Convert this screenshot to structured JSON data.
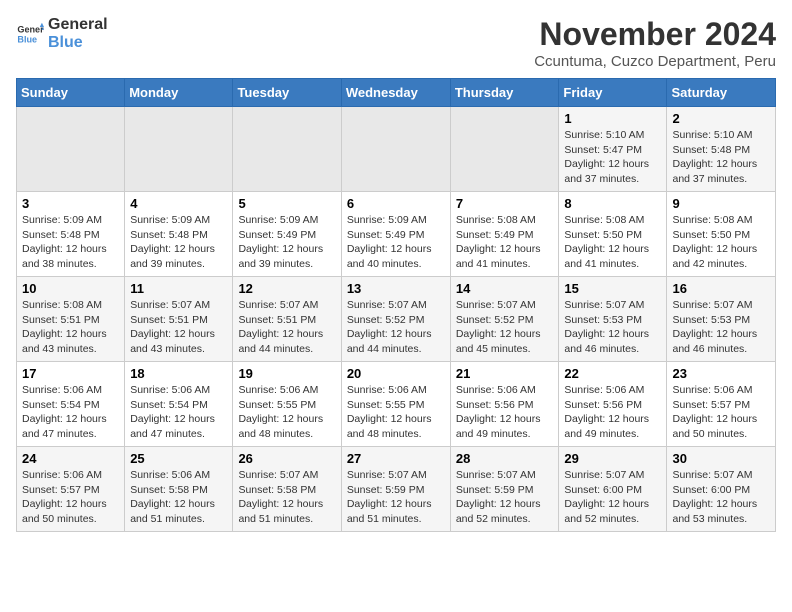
{
  "logo": {
    "line1": "General",
    "line2": "Blue"
  },
  "title": "November 2024",
  "subtitle": "Ccuntuma, Cuzco Department, Peru",
  "weekdays": [
    "Sunday",
    "Monday",
    "Tuesday",
    "Wednesday",
    "Thursday",
    "Friday",
    "Saturday"
  ],
  "weeks": [
    [
      {
        "day": "",
        "info": ""
      },
      {
        "day": "",
        "info": ""
      },
      {
        "day": "",
        "info": ""
      },
      {
        "day": "",
        "info": ""
      },
      {
        "day": "",
        "info": ""
      },
      {
        "day": "1",
        "info": "Sunrise: 5:10 AM\nSunset: 5:47 PM\nDaylight: 12 hours\nand 37 minutes."
      },
      {
        "day": "2",
        "info": "Sunrise: 5:10 AM\nSunset: 5:48 PM\nDaylight: 12 hours\nand 37 minutes."
      }
    ],
    [
      {
        "day": "3",
        "info": "Sunrise: 5:09 AM\nSunset: 5:48 PM\nDaylight: 12 hours\nand 38 minutes."
      },
      {
        "day": "4",
        "info": "Sunrise: 5:09 AM\nSunset: 5:48 PM\nDaylight: 12 hours\nand 39 minutes."
      },
      {
        "day": "5",
        "info": "Sunrise: 5:09 AM\nSunset: 5:49 PM\nDaylight: 12 hours\nand 39 minutes."
      },
      {
        "day": "6",
        "info": "Sunrise: 5:09 AM\nSunset: 5:49 PM\nDaylight: 12 hours\nand 40 minutes."
      },
      {
        "day": "7",
        "info": "Sunrise: 5:08 AM\nSunset: 5:49 PM\nDaylight: 12 hours\nand 41 minutes."
      },
      {
        "day": "8",
        "info": "Sunrise: 5:08 AM\nSunset: 5:50 PM\nDaylight: 12 hours\nand 41 minutes."
      },
      {
        "day": "9",
        "info": "Sunrise: 5:08 AM\nSunset: 5:50 PM\nDaylight: 12 hours\nand 42 minutes."
      }
    ],
    [
      {
        "day": "10",
        "info": "Sunrise: 5:08 AM\nSunset: 5:51 PM\nDaylight: 12 hours\nand 43 minutes."
      },
      {
        "day": "11",
        "info": "Sunrise: 5:07 AM\nSunset: 5:51 PM\nDaylight: 12 hours\nand 43 minutes."
      },
      {
        "day": "12",
        "info": "Sunrise: 5:07 AM\nSunset: 5:51 PM\nDaylight: 12 hours\nand 44 minutes."
      },
      {
        "day": "13",
        "info": "Sunrise: 5:07 AM\nSunset: 5:52 PM\nDaylight: 12 hours\nand 44 minutes."
      },
      {
        "day": "14",
        "info": "Sunrise: 5:07 AM\nSunset: 5:52 PM\nDaylight: 12 hours\nand 45 minutes."
      },
      {
        "day": "15",
        "info": "Sunrise: 5:07 AM\nSunset: 5:53 PM\nDaylight: 12 hours\nand 46 minutes."
      },
      {
        "day": "16",
        "info": "Sunrise: 5:07 AM\nSunset: 5:53 PM\nDaylight: 12 hours\nand 46 minutes."
      }
    ],
    [
      {
        "day": "17",
        "info": "Sunrise: 5:06 AM\nSunset: 5:54 PM\nDaylight: 12 hours\nand 47 minutes."
      },
      {
        "day": "18",
        "info": "Sunrise: 5:06 AM\nSunset: 5:54 PM\nDaylight: 12 hours\nand 47 minutes."
      },
      {
        "day": "19",
        "info": "Sunrise: 5:06 AM\nSunset: 5:55 PM\nDaylight: 12 hours\nand 48 minutes."
      },
      {
        "day": "20",
        "info": "Sunrise: 5:06 AM\nSunset: 5:55 PM\nDaylight: 12 hours\nand 48 minutes."
      },
      {
        "day": "21",
        "info": "Sunrise: 5:06 AM\nSunset: 5:56 PM\nDaylight: 12 hours\nand 49 minutes."
      },
      {
        "day": "22",
        "info": "Sunrise: 5:06 AM\nSunset: 5:56 PM\nDaylight: 12 hours\nand 49 minutes."
      },
      {
        "day": "23",
        "info": "Sunrise: 5:06 AM\nSunset: 5:57 PM\nDaylight: 12 hours\nand 50 minutes."
      }
    ],
    [
      {
        "day": "24",
        "info": "Sunrise: 5:06 AM\nSunset: 5:57 PM\nDaylight: 12 hours\nand 50 minutes."
      },
      {
        "day": "25",
        "info": "Sunrise: 5:06 AM\nSunset: 5:58 PM\nDaylight: 12 hours\nand 51 minutes."
      },
      {
        "day": "26",
        "info": "Sunrise: 5:07 AM\nSunset: 5:58 PM\nDaylight: 12 hours\nand 51 minutes."
      },
      {
        "day": "27",
        "info": "Sunrise: 5:07 AM\nSunset: 5:59 PM\nDaylight: 12 hours\nand 51 minutes."
      },
      {
        "day": "28",
        "info": "Sunrise: 5:07 AM\nSunset: 5:59 PM\nDaylight: 12 hours\nand 52 minutes."
      },
      {
        "day": "29",
        "info": "Sunrise: 5:07 AM\nSunset: 6:00 PM\nDaylight: 12 hours\nand 52 minutes."
      },
      {
        "day": "30",
        "info": "Sunrise: 5:07 AM\nSunset: 6:00 PM\nDaylight: 12 hours\nand 53 minutes."
      }
    ]
  ]
}
